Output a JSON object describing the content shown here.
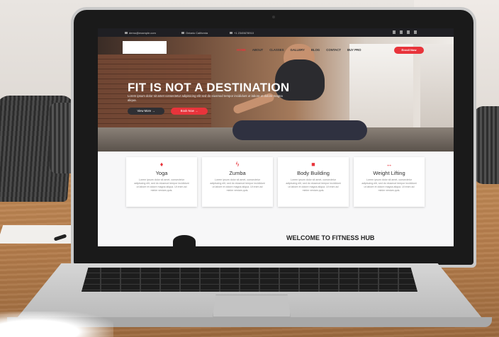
{
  "topbar": {
    "email": "demo@example.com",
    "location": "Ontario California",
    "phone": "+1 2345678910"
  },
  "nav": {
    "menu": [
      "HOME",
      "ABOUT",
      "CLASSES",
      "GALLERY",
      "BLOG",
      "CONTACT",
      "BUY PRO"
    ],
    "enroll_label": "Enroll Now"
  },
  "hero": {
    "title": "FIT IS NOT A DESTINATION",
    "subtitle": "Lorem ipsum dolor sit amet consectetur adipisicing elit sed do eiusmod tempor incididunt ut labore et dolore magna aliqua.",
    "more_label": "View More →",
    "book_label": "Book Now →"
  },
  "cards": [
    {
      "icon": "dumbbell-icon",
      "title": "Yoga",
      "text": "Lorem ipsum dolor sit amet, consectetur adipiscing elit, sed do eiusmod tempor incididunt ut labore et dolore magna aliqua. Ut enim ad minim veniam,quis."
    },
    {
      "icon": "lightning-icon",
      "title": "Zumba",
      "text": "Lorem ipsum dolor sit amet, consectetur adipiscing elit, sed do eiusmod tempor incididunt ut labore et dolore magna aliqua. Ut enim ad minim veniam,quis."
    },
    {
      "icon": "kettlebell-icon",
      "title": "Body Building",
      "text": "Lorem ipsum dolor sit amet, consectetur adipiscing elit, sed do eiusmod tempor incididunt ut labore et dolore magna aliqua. Ut enim ad minim veniam,quis."
    },
    {
      "icon": "barbell-icon",
      "title": "Weight Lifting",
      "text": "Lorem ipsum dolor sit amet, consectetur adipiscing elit, sed do eiusmod tempor incididunt ut labore et dolore magna aliqua. Ut enim ad minim veniam,quis."
    }
  ],
  "welcome": "WELCOME TO FITNESS HUB",
  "colors": {
    "accent": "#e8343b",
    "topbar": "#1f1f23"
  }
}
